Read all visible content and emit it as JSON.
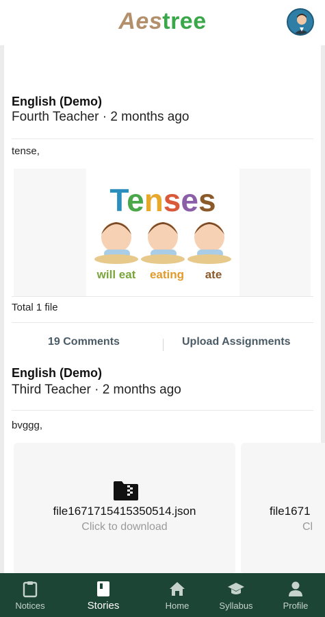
{
  "app": {
    "logo_part1": "Aes",
    "logo_part2": "tree"
  },
  "posts": [
    {
      "subject": "English (Demo)",
      "teacher_line": "Fourth Teacher · 2 months ago",
      "text": "tense,",
      "image": {
        "title": "Tenses",
        "labels": [
          "will eat",
          "eating",
          "ate"
        ]
      },
      "total_files": "Total 1 file",
      "actions": {
        "comments": "19 Comments",
        "upload": "Upload Assignments"
      }
    },
    {
      "subject": "English (Demo)",
      "teacher_line": "Third Teacher · 2 months ago",
      "text": "bvggg,",
      "files": [
        {
          "name": "file1671715415350514.json",
          "hint": "Click to download"
        },
        {
          "name": "file1671",
          "hint": "Cl"
        }
      ]
    }
  ],
  "nav": [
    {
      "label": "Notices",
      "icon": "clipboard-icon",
      "active": false
    },
    {
      "label": "Stories",
      "icon": "book-icon",
      "active": true
    },
    {
      "label": "Home",
      "icon": "home-icon",
      "active": false
    },
    {
      "label": "Syllabus",
      "icon": "graduation-cap-icon",
      "active": false
    },
    {
      "label": "Profile",
      "icon": "person-icon",
      "active": false
    }
  ],
  "colors": {
    "nav_bg": "#1d4536",
    "logo_brown": "#b3906b",
    "logo_green": "#3aa84a"
  }
}
